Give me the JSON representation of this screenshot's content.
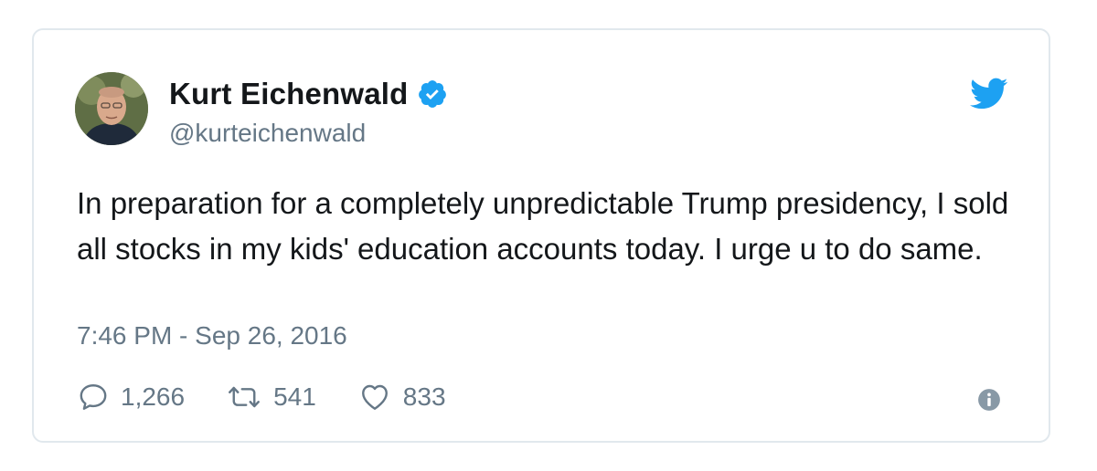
{
  "tweet": {
    "author": {
      "display_name": "Kurt Eichenwald",
      "handle": "@kurteichenwald",
      "verified": true
    },
    "text": "In preparation for a completely unpredictable Trump presidency, I sold all stocks in my kids' education accounts today. I urge u to do same.",
    "timestamp": "7:46 PM - Sep 26, 2016",
    "stats": {
      "replies": "1,266",
      "retweets": "541",
      "likes": "833"
    }
  },
  "icons": {
    "verified": "verified-badge-icon",
    "brand": "twitter-bird-icon",
    "reply": "reply-icon",
    "retweet": "retweet-icon",
    "like": "heart-icon",
    "info": "info-icon"
  },
  "colors": {
    "brand_blue": "#1da1f2",
    "text_primary": "#14171a",
    "text_secondary": "#657786",
    "border": "#e1e8ed"
  }
}
